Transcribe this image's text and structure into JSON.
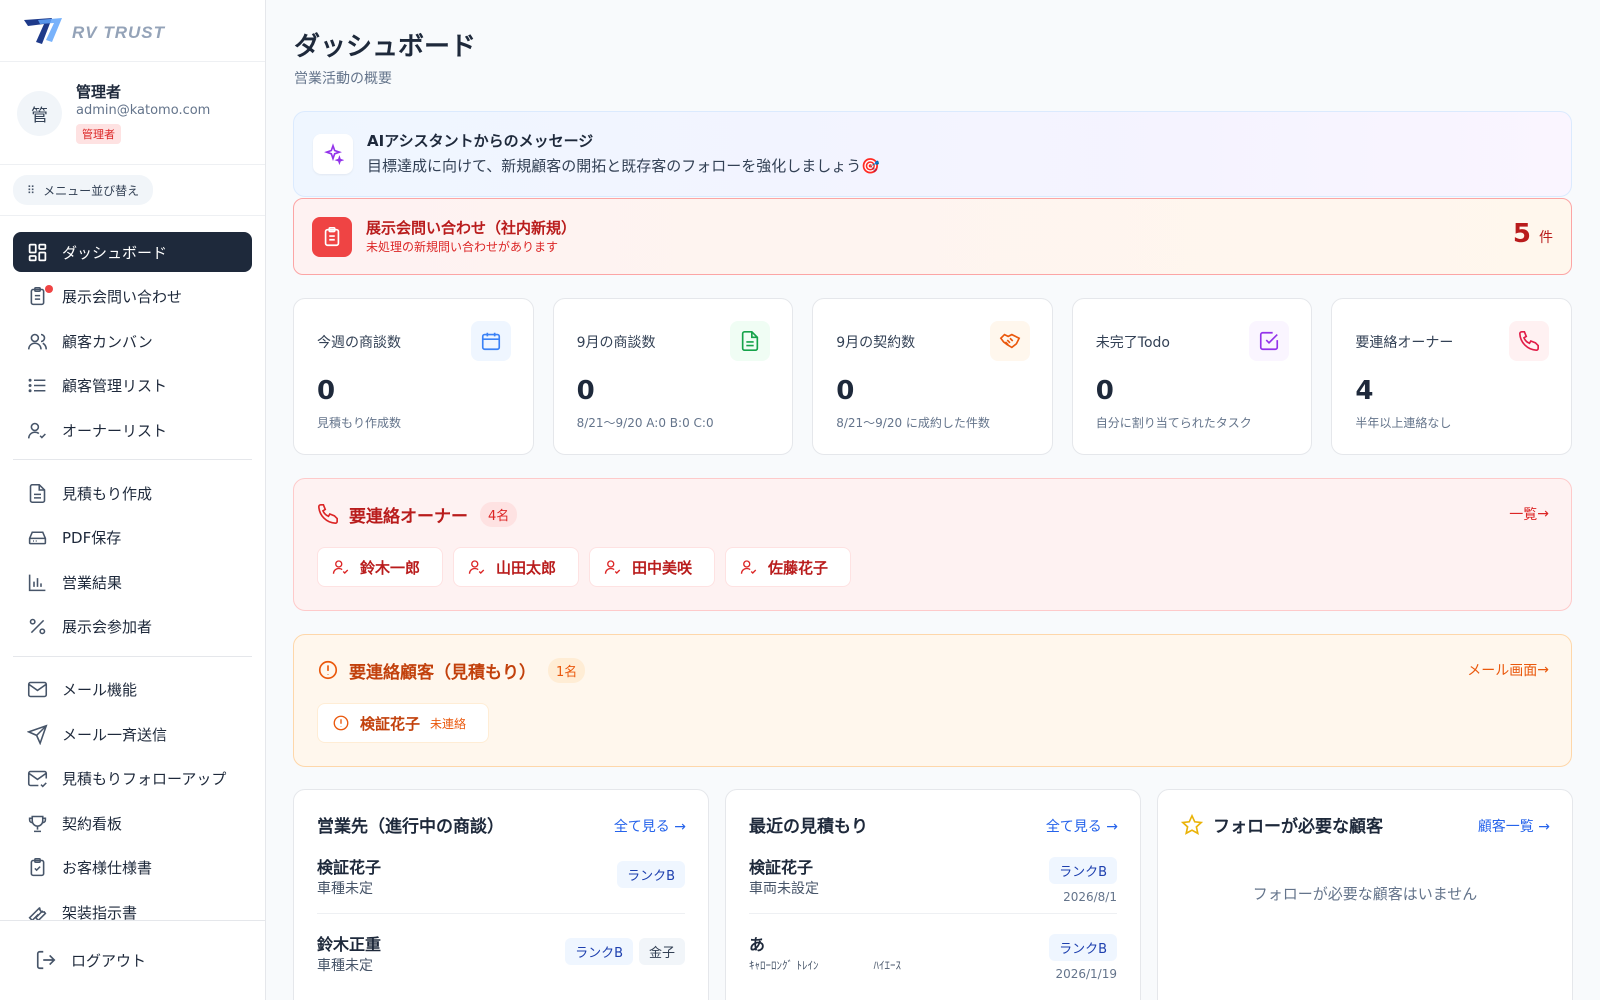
{
  "brand": {
    "logo_text": "RV TRUST"
  },
  "user": {
    "avatar_initial": "管",
    "name": "管理者",
    "email": "admin@katomo.com",
    "role": "管理者"
  },
  "sidebar": {
    "reorder_label": "メニュー並び替え",
    "items": [
      {
        "label": "ダッシュボード",
        "icon": "dashboard-icon"
      },
      {
        "label": "展示会問い合わせ",
        "icon": "clipboard-icon"
      },
      {
        "label": "顧客カンバン",
        "icon": "users-icon"
      },
      {
        "label": "顧客管理リスト",
        "icon": "list-icon"
      },
      {
        "label": "オーナーリスト",
        "icon": "user-check-icon"
      },
      {
        "label": "見積もり作成",
        "icon": "document-icon"
      },
      {
        "label": "PDF保存",
        "icon": "drive-icon"
      },
      {
        "label": "営業結果",
        "icon": "bar-chart-icon"
      },
      {
        "label": "展示会参加者",
        "icon": "percent-icon"
      },
      {
        "label": "メール機能",
        "icon": "mail-icon"
      },
      {
        "label": "メール一斉送信",
        "icon": "send-icon"
      },
      {
        "label": "見積もりフォローアップ",
        "icon": "mail-check-icon"
      },
      {
        "label": "契約看板",
        "icon": "trophy-icon"
      },
      {
        "label": "お客様仕様書",
        "icon": "clipboard-check-icon"
      },
      {
        "label": "架装指示書",
        "icon": "wrench-icon"
      }
    ],
    "logout_label": "ログアウト"
  },
  "header": {
    "title": "ダッシュボード",
    "subtitle": "営業活動の概要"
  },
  "ai": {
    "title": "AIアシスタントからのメッセージ",
    "message": "目標達成に向けて、新規顧客の開拓と既存客のフォローを強化しましょう🎯"
  },
  "alert": {
    "title": "展示会問い合わせ（社内新規）",
    "subtitle": "未処理の新規問い合わせがあります",
    "count": "5",
    "unit": "件"
  },
  "stats": [
    {
      "label": "今週の商談数",
      "value": "0",
      "sub": "見積もり作成数",
      "icon": "calendar-icon",
      "color": "#3b82f6",
      "bg": "#eff6ff"
    },
    {
      "label": "9月の商談数",
      "value": "0",
      "sub": "8/21〜9/20 A:0 B:0 C:0",
      "icon": "file-text-icon",
      "color": "#16a34a",
      "bg": "#f0fdf4"
    },
    {
      "label": "9月の契約数",
      "value": "0",
      "sub": "8/21〜9/20 に成約した件数",
      "icon": "handshake-icon",
      "color": "#ea580c",
      "bg": "#fff7ed"
    },
    {
      "label": "未完了Todo",
      "value": "0",
      "sub": "自分に割り当てられたタスク",
      "icon": "check-square-icon",
      "color": "#9333ea",
      "bg": "#faf5ff"
    },
    {
      "label": "要連絡オーナー",
      "value": "4",
      "sub": "半年以上連絡なし",
      "icon": "phone-icon",
      "color": "#e11d48",
      "bg": "#fff1f2"
    }
  ],
  "owners": {
    "title": "要連絡オーナー",
    "count": "4名",
    "link": "一覧",
    "names": [
      "鈴木一郎",
      "山田太郎",
      "田中美咲",
      "佐藤花子"
    ]
  },
  "customers": {
    "title": "要連絡顧客（見積もり）",
    "count": "1名",
    "link": "メール画面",
    "items": [
      {
        "name": "検証花子",
        "status": "未連絡"
      }
    ]
  },
  "deals": {
    "title": "営業先（進行中の商談）",
    "link": "全て見る",
    "rows": [
      {
        "name": "検証花子",
        "sub": "車種未定",
        "rank": "ランクB",
        "staff": ""
      },
      {
        "name": "鈴木正重",
        "sub": "車種未定",
        "rank": "ランクB",
        "staff": "金子"
      }
    ]
  },
  "estimates": {
    "title": "最近の見積もり",
    "link": "全て見る",
    "rows": [
      {
        "name": "検証花子",
        "sub": "車両未設定",
        "rank": "ランクB",
        "date": "2026/8/1"
      },
      {
        "name": "あ",
        "sub": "ｷｬﾛｰﾛﾝｸﾞ ﾄﾚｲﾝ　　　　　ﾊｲｴｰｽ",
        "rank": "ランクB",
        "date": "2026/1/19"
      }
    ]
  },
  "follow": {
    "title": "フォローが必要な顧客",
    "link": "顧客一覧",
    "empty": "フォローが必要な顧客はいません"
  },
  "arrow": "→"
}
